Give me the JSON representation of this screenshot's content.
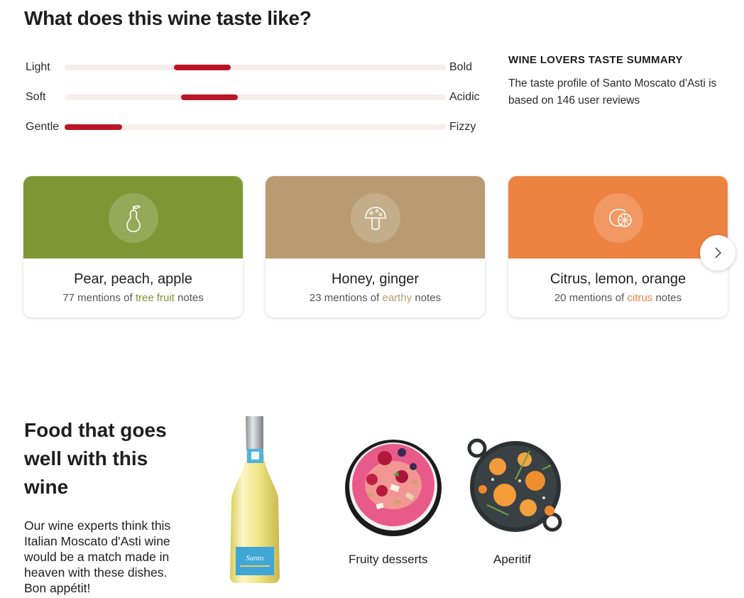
{
  "taste": {
    "title": "What does this wine taste like?",
    "scales": [
      {
        "left": "Light",
        "right": "Bold",
        "value_start": 0.286,
        "value_end": 0.436
      },
      {
        "left": "Soft",
        "right": "Acidic",
        "value_start": 0.305,
        "value_end": 0.455
      },
      {
        "left": "Gentle",
        "right": "Fizzy",
        "value_start": 0.0,
        "value_end": 0.15
      }
    ],
    "summary_heading": "WINE LOVERS TASTE SUMMARY",
    "summary_text": "The taste profile of Santo Moscato d'Asti is based on 146 user reviews"
  },
  "notes": [
    {
      "icon": "pear-icon",
      "color": "#7f9634",
      "title": "Pear, peach, apple",
      "count_text": "77 mentions of",
      "category": "tree fruit",
      "suffix": "notes"
    },
    {
      "icon": "mushroom-icon",
      "color": "#b89b70",
      "title": "Honey, ginger",
      "count_text": "23 mentions of",
      "category": "earthy",
      "suffix": "notes"
    },
    {
      "icon": "citrus-icon",
      "color": "#ee8241",
      "title": "Citrus, lemon, orange",
      "count_text": "20 mentions of",
      "category": "citrus",
      "suffix": "notes"
    }
  ],
  "next_icon": "chevron-right-icon",
  "food": {
    "heading": "Food that goes well with this wine",
    "text": "Our wine experts think this Italian Moscato d'Asti wine would be a match made in heaven with these dishes. Bon appétit!",
    "bottle_label": "Santo",
    "pairings": [
      {
        "label": "Fruity desserts"
      },
      {
        "label": "Aperitif"
      }
    ]
  }
}
